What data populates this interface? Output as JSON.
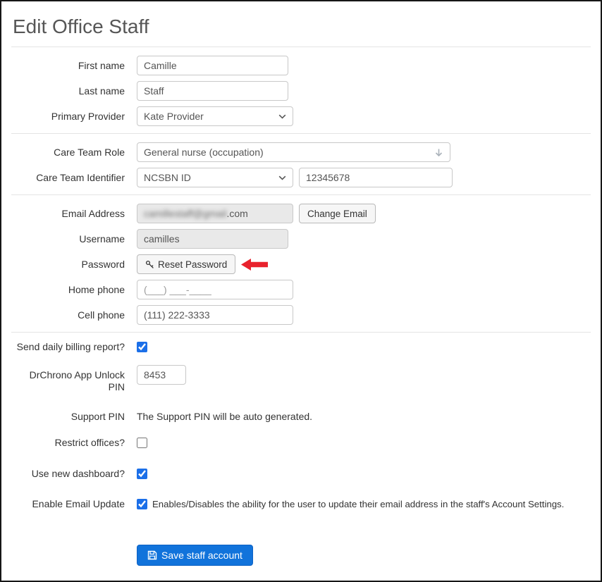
{
  "page": {
    "title": "Edit Office Staff"
  },
  "colors": {
    "accent_blue": "#1b6fe8",
    "save_button_blue": "#1173db",
    "arrow_red": "#e8222d",
    "disabled_field_bg": "#e9e9e9"
  },
  "form": {
    "first_name": {
      "label": "First name",
      "value": "Camille"
    },
    "last_name": {
      "label": "Last name",
      "value": "Staff"
    },
    "primary_provider": {
      "label": "Primary Provider",
      "value": "Kate Provider"
    },
    "care_team_role": {
      "label": "Care Team Role",
      "value": "General nurse (occupation)"
    },
    "care_team_identifier": {
      "label": "Care Team Identifier",
      "type_value": "NCSBN ID",
      "id_value": "12345678"
    },
    "email": {
      "label": "Email Address",
      "masked_value": "camillestaff@gmail",
      "visible_suffix": ".com",
      "change_button": "Change Email"
    },
    "username": {
      "label": "Username",
      "value": "camilles"
    },
    "password": {
      "label": "Password",
      "reset_button": "Reset Password"
    },
    "home_phone": {
      "label": "Home phone",
      "placeholder": "(___) ___-____"
    },
    "cell_phone": {
      "label": "Cell phone",
      "value": "(111) 222-3333"
    },
    "daily_billing": {
      "label": "Send daily billing report?",
      "checked": true
    },
    "unlock_pin": {
      "label": "DrChrono App Unlock PIN",
      "value": "8453"
    },
    "support_pin": {
      "label": "Support PIN",
      "text": "The Support PIN will be auto generated."
    },
    "restrict_offices": {
      "label": "Restrict offices?",
      "checked": false
    },
    "new_dashboard": {
      "label": "Use new dashboard?",
      "checked": true
    },
    "email_update": {
      "label": "Enable Email Update",
      "checked": true,
      "description": "Enables/Disables the ability for the user to update their email address in the staff's Account Settings."
    },
    "save_button": "Save staff account"
  }
}
